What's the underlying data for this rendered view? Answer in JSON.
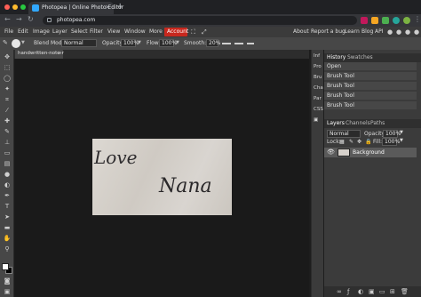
{
  "browser": {
    "tab_title": "Photopea | Online Photo Editor",
    "tab_close": "×",
    "new_tab": "+",
    "url": "photopea.com",
    "nav": {
      "back": "←",
      "forward": "→",
      "reload": "↻"
    },
    "colors": {
      "close": "#ff5f57",
      "minimize": "#febc2e",
      "zoom": "#28c840"
    }
  },
  "menubar": {
    "items": [
      "File",
      "Edit",
      "Image",
      "Layer",
      "Select",
      "Filter",
      "View",
      "Window",
      "More"
    ],
    "account": "Account",
    "right_items": [
      "About",
      "Report a bug",
      "Learn",
      "Blog",
      "API"
    ],
    "accent": "#c8281e"
  },
  "options": {
    "blend_label": "Blend Mode:",
    "blend_value": "Normal",
    "opacity_label": "Opacity:",
    "opacity_value": "100%",
    "flow_label": "Flow:",
    "flow_value": "100%",
    "smooth_label": "Smooth:",
    "smooth_value": "20%"
  },
  "document": {
    "tab_name": "handwritten-note-r",
    "close": "×",
    "handwriting_line1": "Love",
    "handwriting_line2": "Nana"
  },
  "right_column": [
    "Inf",
    "Pro",
    "Bru",
    "Cha",
    "Par",
    "CSS"
  ],
  "history": {
    "tabs": [
      "History",
      "Swatches"
    ],
    "items": [
      "Open",
      "Brush Tool",
      "Brush Tool",
      "Brush Tool",
      "Brush Tool"
    ]
  },
  "layers": {
    "tabs": [
      "Layers",
      "Channels",
      "Paths"
    ],
    "blend_value": "Normal",
    "opacity_label": "Opacity:",
    "opacity_value": "100%",
    "lock_label": "Lock:",
    "fill_label": "Fill:",
    "fill_value": "100%",
    "layer_name": "Background"
  }
}
